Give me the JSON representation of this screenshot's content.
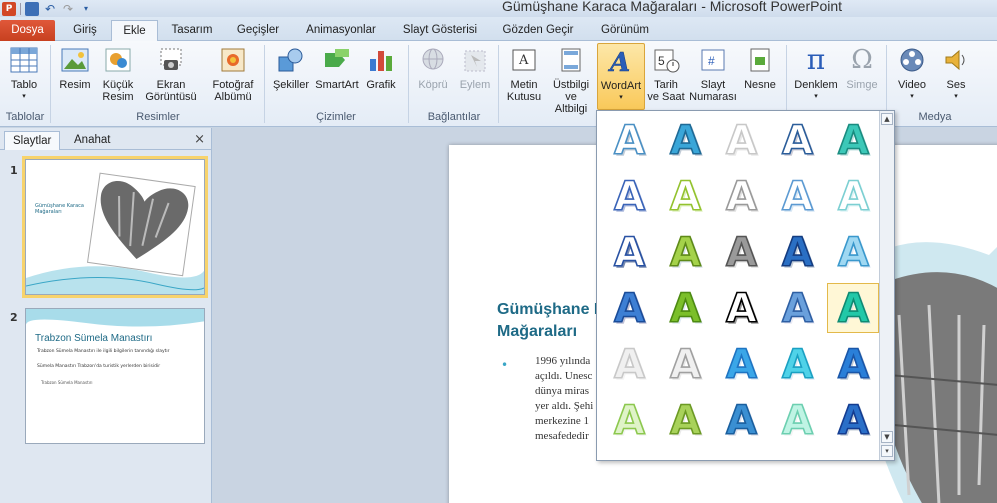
{
  "window": {
    "title": "Gümüşhane Karaca Mağaraları  -  Microsoft PowerPoint"
  },
  "tabs": [
    "Dosya",
    "Giriş",
    "Ekle",
    "Tasarım",
    "Geçişler",
    "Animasyonlar",
    "Slayt Gösterisi",
    "Gözden Geçir",
    "Görünüm"
  ],
  "active_tab": "Ekle",
  "ribbon": {
    "buttons": [
      {
        "line1": "Tablo",
        "line2": "",
        "group": "Tablolar"
      },
      {
        "line1": "Resim",
        "line2": ""
      },
      {
        "line1": "Küçük",
        "line2": "Resim"
      },
      {
        "line1": "Ekran",
        "line2": "Görüntüsü"
      },
      {
        "line1": "Fotoğraf",
        "line2": "Albümü"
      },
      {
        "line1": "Şekiller",
        "line2": ""
      },
      {
        "line1": "SmartArt",
        "line2": ""
      },
      {
        "line1": "Grafik",
        "line2": ""
      },
      {
        "line1": "Köprü",
        "line2": ""
      },
      {
        "line1": "Eylem",
        "line2": ""
      },
      {
        "line1": "Metin",
        "line2": "Kutusu"
      },
      {
        "line1": "Üstbilgi",
        "line2": "ve Altbilgi"
      },
      {
        "line1": "WordArt",
        "line2": ""
      },
      {
        "line1": "Tarih",
        "line2": "ve Saat"
      },
      {
        "line1": "Slayt",
        "line2": "Numarası"
      },
      {
        "line1": "Nesne",
        "line2": ""
      },
      {
        "line1": "Denklem",
        "line2": ""
      },
      {
        "line1": "Simge",
        "line2": ""
      },
      {
        "line1": "Video",
        "line2": ""
      },
      {
        "line1": "Ses",
        "line2": ""
      }
    ],
    "groups": [
      "Tablolar",
      "Resimler",
      "Çizimler",
      "Bağlantılar",
      "Medya"
    ]
  },
  "left_pane": {
    "tabs": [
      "Slaytlar",
      "Anahat"
    ],
    "close": "×",
    "slides": [
      {
        "number": "1",
        "title": "Gümüşhane Karaca Mağaraları"
      },
      {
        "number": "2",
        "title": "Trabzon Sümela Manastırı",
        "bullets": [
          "Trabzon Sümela Manastırı ile ilgili bilgilerin tanındığı slaytır",
          "Sümela Manastırı Trabzon'da turistik yerlerden birisidir"
        ],
        "sub": [
          "Trabzon Sümela Manastırı"
        ]
      }
    ]
  },
  "slide": {
    "title_line1": "Gümüşhane K",
    "title_line2": "Mağaraları",
    "body": [
      "1996 yılında",
      "açıldı. Unesc",
      "dünya miras",
      "yer aldı. Şehi",
      "merkezine 1",
      "mesafededir"
    ]
  },
  "gallery": {
    "glyph": "A",
    "selected_index": 19,
    "styles": [
      {
        "fill": "#ffffff",
        "stroke": "#4a90c4",
        "shadow": "#9ab"
      },
      {
        "fill": "#3aa6d8",
        "stroke": "#1e6a96",
        "shadow": "#9ab"
      },
      {
        "fill": "#ffffff",
        "stroke": "#c8c8c8",
        "shadow": "#ddd"
      },
      {
        "fill": "#ffffff",
        "stroke": "#2b5d9a",
        "shadow": "#aab"
      },
      {
        "fill": "#3cc8b8",
        "stroke": "#1a8c80",
        "shadow": "#9cc"
      },
      {
        "fill": "#ffffff",
        "stroke": "#3a64b8",
        "shadow": "#7b8fc8"
      },
      {
        "fill": "#ffffff",
        "stroke": "#93c22e",
        "shadow": "#cde89a"
      },
      {
        "fill": "#ffffff",
        "stroke": "#9a9a9a",
        "shadow": "#ccc"
      },
      {
        "fill": "#ffffff",
        "stroke": "#5c9ad2",
        "shadow": "#bcd6ee"
      },
      {
        "fill": "#ffffff",
        "stroke": "#7ccfd2",
        "shadow": "#cdeef0"
      },
      {
        "fill": "#ffffff",
        "stroke": "#2952a3",
        "shadow": "#1a3a7a"
      },
      {
        "fill": "#a4d24a",
        "stroke": "#5e8a18",
        "shadow": "#bcd"
      },
      {
        "fill": "#9a9a9a",
        "stroke": "#555555",
        "shadow": "#ccc"
      },
      {
        "fill": "#2a6fc4",
        "stroke": "#143c80",
        "shadow": "#9ab"
      },
      {
        "fill": "#9fd8f2",
        "stroke": "#3a98cc",
        "shadow": "#cde"
      },
      {
        "fill": "#3d7fd4",
        "stroke": "#1a4c99",
        "shadow": "#99b"
      },
      {
        "fill": "#7bbf2a",
        "stroke": "#4d8a12",
        "shadow": "#cde"
      },
      {
        "fill": "#ffffff",
        "stroke": "#000000",
        "shadow": "#555"
      },
      {
        "fill": "#6aa0dc",
        "stroke": "#2e5fa3",
        "shadow": "#dde"
      },
      {
        "fill": "#22c8a8",
        "stroke": "#0f8a72",
        "shadow": "#cde"
      },
      {
        "fill": "#f0f0f0",
        "stroke": "#c8c8c8",
        "shadow": "#eee"
      },
      {
        "fill": "#f0f0f0",
        "stroke": "#a0a0a0",
        "shadow": "#ddd"
      },
      {
        "fill": "#3aa6e8",
        "stroke": "#1e74c2",
        "shadow": "#cde"
      },
      {
        "fill": "#4fd2e8",
        "stroke": "#1aa0c2",
        "shadow": "#cde"
      },
      {
        "fill": "#2a7fd8",
        "stroke": "#1a56a8",
        "shadow": "#9ab"
      },
      {
        "fill": "#dff3c8",
        "stroke": "#8cc84e",
        "shadow": "#eee"
      },
      {
        "fill": "#a8d25a",
        "stroke": "#6c9a24",
        "shadow": "#ddd"
      },
      {
        "fill": "#3a8fd2",
        "stroke": "#1a5f9e",
        "shadow": "#ccd"
      },
      {
        "fill": "#bff4e4",
        "stroke": "#6ccfb0",
        "shadow": "#eee"
      },
      {
        "fill": "#2a6fc8",
        "stroke": "#143c90",
        "shadow": "#9ab"
      }
    ]
  }
}
